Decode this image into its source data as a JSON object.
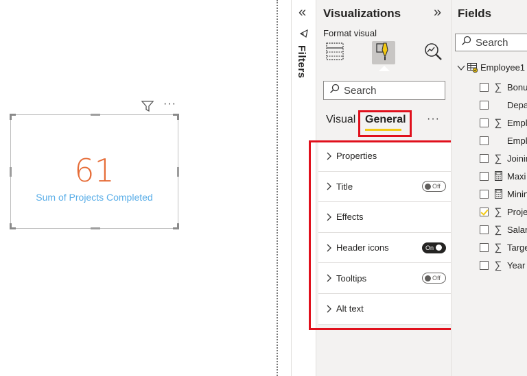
{
  "canvas": {
    "card": {
      "value": "61",
      "label": "Sum of Projects Completed",
      "value_color": "#e66c37",
      "label_color": "#5aaee8"
    },
    "toolbar_icons": [
      "filter-icon",
      "more-options-icon"
    ]
  },
  "filters_pane": {
    "label": "Filters",
    "collapse_glyph": "«"
  },
  "visualizations": {
    "title": "Visualizations",
    "expand_glyph": "»",
    "format_label": "Format visual",
    "icons": [
      "table-icon",
      "format-brush-icon",
      "analytics-icon"
    ],
    "search": {
      "placeholder": "Search",
      "value": ""
    },
    "tabs": [
      {
        "label": "Visual",
        "selected": false
      },
      {
        "label": "General",
        "selected": true
      }
    ],
    "more_glyph": "···",
    "sections": [
      {
        "name": "Properties",
        "toggle": null
      },
      {
        "name": "Title",
        "toggle": "Off"
      },
      {
        "name": "Effects",
        "toggle": null
      },
      {
        "name": "Header icons",
        "toggle": "On"
      },
      {
        "name": "Tooltips",
        "toggle": "Off"
      },
      {
        "name": "Alt text",
        "toggle": null
      }
    ],
    "highlight_color": "#e0101c",
    "accent_color": "#f2c811"
  },
  "fields": {
    "title": "Fields",
    "search": {
      "placeholder": "Search",
      "value": ""
    },
    "table": {
      "name": "Employee1",
      "expanded": true
    },
    "items": [
      {
        "name": "Bonu",
        "icon": "sigma",
        "checked": false
      },
      {
        "name": "Depa",
        "icon": "none",
        "checked": false
      },
      {
        "name": "Empl",
        "icon": "sigma",
        "checked": false
      },
      {
        "name": "Empl",
        "icon": "none",
        "checked": false
      },
      {
        "name": "Joinin",
        "icon": "sigma",
        "checked": false
      },
      {
        "name": "Maxi",
        "icon": "calculator",
        "checked": false
      },
      {
        "name": "Minin",
        "icon": "calculator",
        "checked": false
      },
      {
        "name": "Proje",
        "icon": "sigma",
        "checked": true
      },
      {
        "name": "Salar",
        "icon": "sigma",
        "checked": false
      },
      {
        "name": "Targe",
        "icon": "sigma",
        "checked": false
      },
      {
        "name": "Year",
        "icon": "sigma",
        "checked": false
      }
    ]
  }
}
